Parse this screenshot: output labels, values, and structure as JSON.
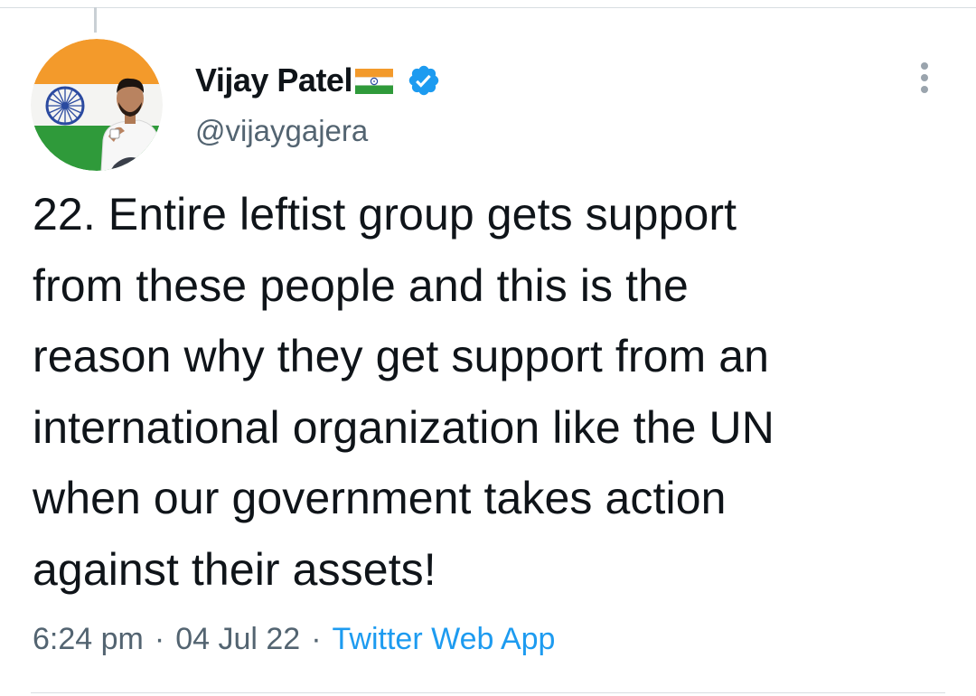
{
  "tweet": {
    "author_name": "Vijay Patel",
    "handle": "@vijaygajera",
    "flag_icon": "india-flag-emoji",
    "verified_icon": "verified-badge-icon",
    "text": "22. Entire leftist group gets support\nfrom these people and this is the\nreason why they get support from an\ninternational organization like the UN\nwhen our government takes action\nagainst their assets!",
    "time": "6:24 pm",
    "date": "04 Jul 22",
    "source": "Twitter Web App",
    "separator": "·"
  },
  "colors": {
    "text_primary": "#0f1419",
    "text_secondary": "#536471",
    "accent_blue": "#1d9bf0",
    "divider": "#d8dde1"
  }
}
